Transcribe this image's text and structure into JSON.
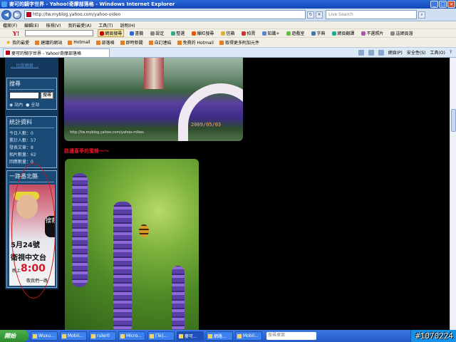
{
  "window": {
    "title": "麥可的騎字世界 - Yahoo!奇摩部落格 - Windows Internet Explorer",
    "buttons": {
      "minimize": "_",
      "maximize": "□",
      "close": "×"
    }
  },
  "address_bar": {
    "url": "http://tw.myblog.yahoo.com/yahoo-video",
    "search_placeholder": "Live Search",
    "back": "◀",
    "forward": "▶"
  },
  "menu": [
    "檔案(F)",
    "編輯(E)",
    "檢視(V)",
    "我的最愛(A)",
    "工具(T)",
    "說明(H)"
  ],
  "yahoo_toolbar": {
    "logo": "Y!",
    "buttons": [
      "網頁搜尋",
      "書籤",
      "設定",
      "整選",
      "爆紅搜尋",
      "信箱",
      "拍賣",
      "知識+",
      "遊戲室",
      "字典",
      "網頁翻譯",
      "不選照片",
      "這網頁溜"
    ]
  },
  "links_bar": {
    "favorites_label": "我的最愛",
    "items": [
      "建議的網站",
      "Hotmail",
      "部落格",
      "即時新聞",
      "自訂連結",
      "免費的 Hotmail",
      "取得更多附加元件"
    ]
  },
  "tab": {
    "label": "麥可的騎字世界 - Yahoo!奇摩部落格",
    "tools": [
      "網頁(P)",
      "安全性(S)",
      "工具(O)",
      "?"
    ]
  },
  "sidebar": {
    "top_link": "... 比從網頁 ...",
    "search": {
      "title": "搜尋",
      "button": "搜尋",
      "radio_site": "站內",
      "radio_all": "全站"
    },
    "stats": {
      "title": "統計資料",
      "rows": [
        "今日人數：0",
        "累計人數：57",
        "發表文章：8",
        "相片數量：62",
        "回應數量：0"
      ]
    },
    "promo": {
      "title": "一路番北縣",
      "date": "5月24號",
      "station": "衛視中文台",
      "time_prefix": "晚上",
      "time": "8:00",
      "tagline": "敬我們一路",
      "badge": "搜救"
    }
  },
  "content": {
    "photo1_text": "http://tw.myblog.yahoo.com/yahoo-mikes",
    "photo1_date": "2009/05/03",
    "caption": "路邊蓋亭的蜜蜂～～"
  },
  "taskbar": {
    "start": "開始",
    "items": [
      "Wuxu...",
      "Mobil...",
      "ruler0",
      "Micro...",
      "[Te]...",
      "麥可...",
      "網路...",
      "Mobil..."
    ],
    "search_placeholder": "搜尋桌面"
  },
  "image_id": "#1070224",
  "colors": {
    "caption": "#e0162b",
    "sidebar_bg": "#14395f",
    "titlebar": "#2a67d8",
    "taskbar": "#2458c6"
  }
}
